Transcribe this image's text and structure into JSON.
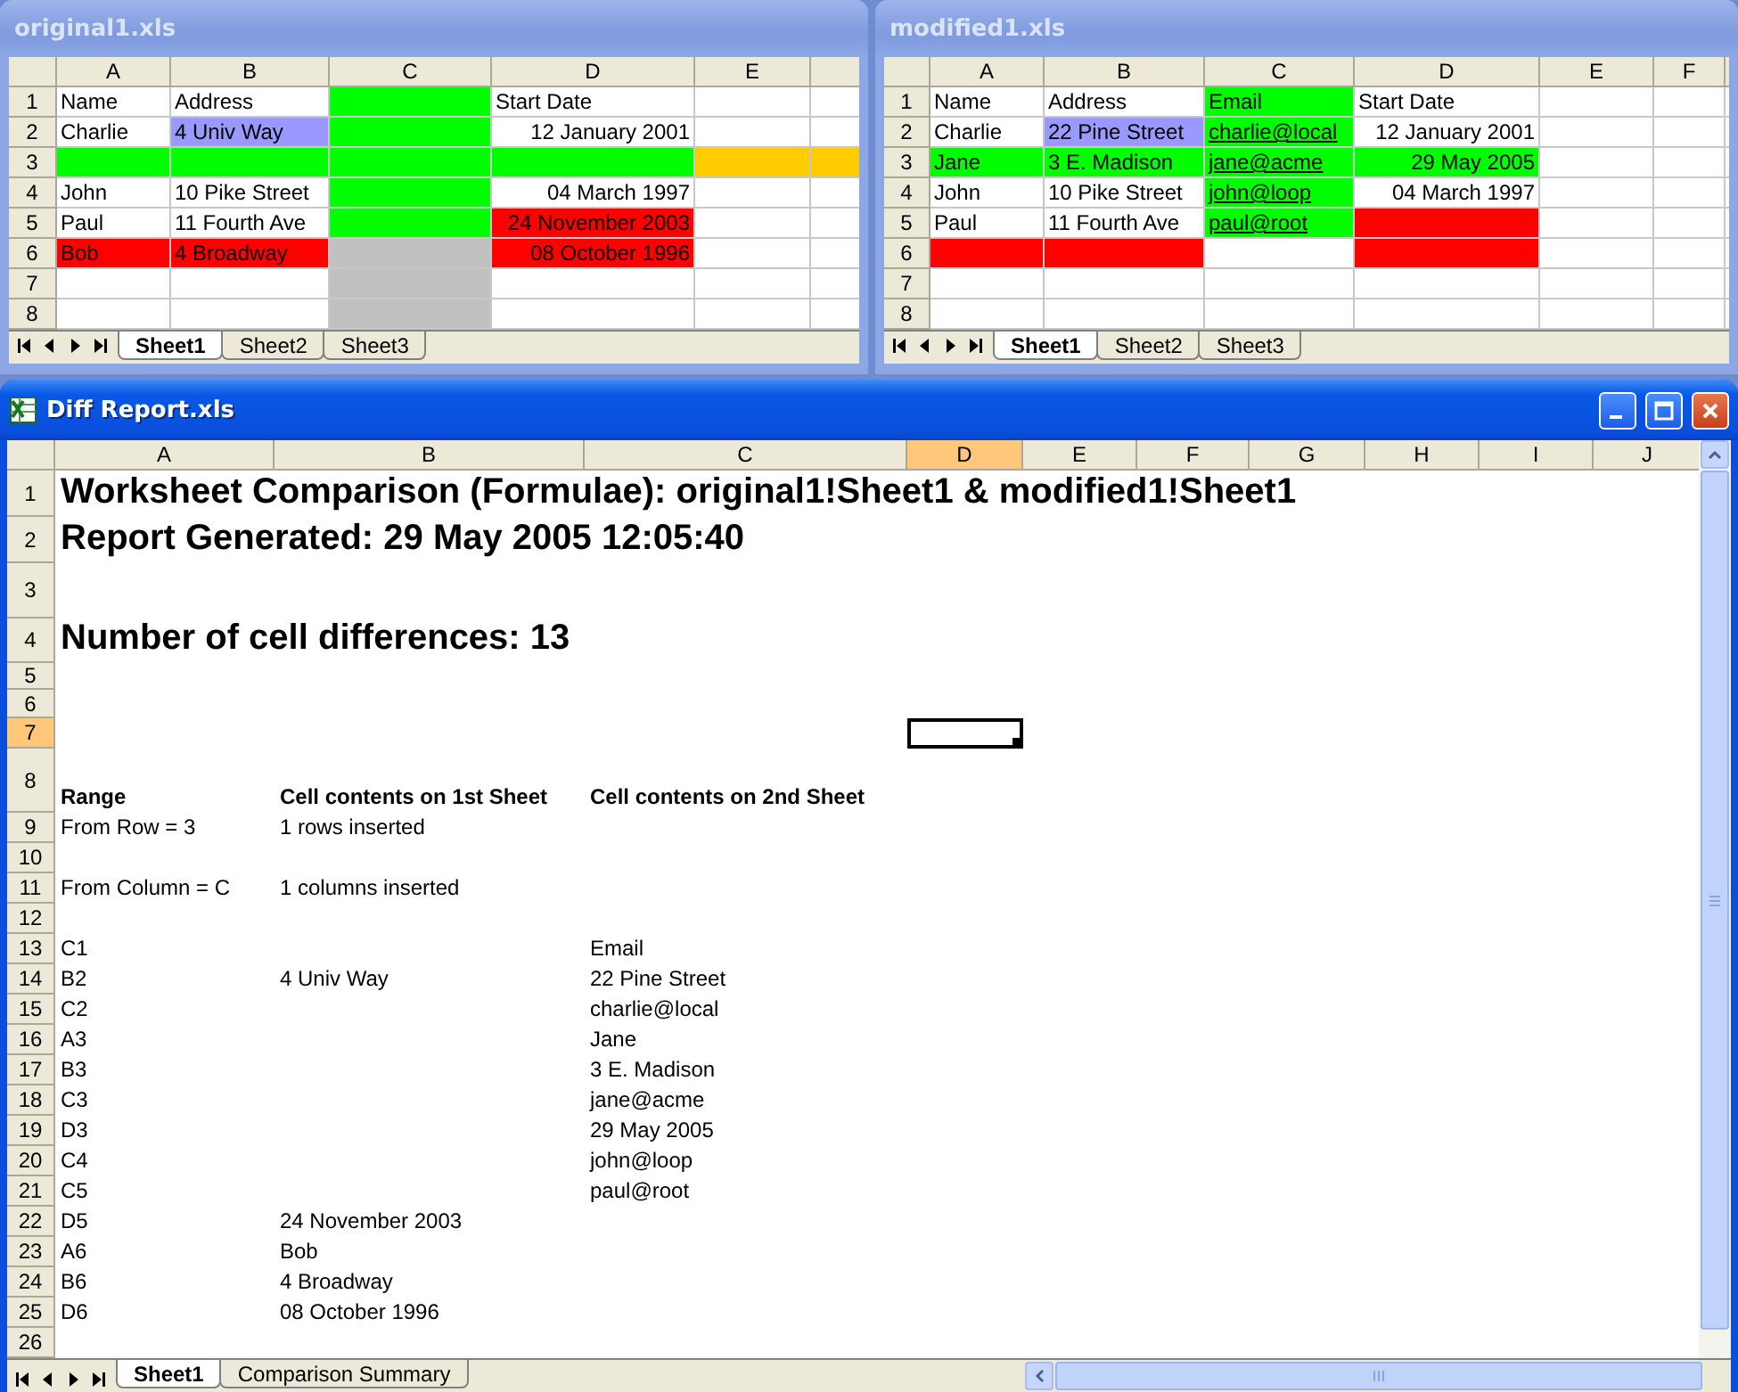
{
  "sheets": [
    {
      "title": "original1.xls",
      "columns": [
        {
          "label": "A"
        },
        {
          "label": "B"
        },
        {
          "label": "C"
        },
        {
          "label": "D"
        },
        {
          "label": "E"
        }
      ],
      "rows": [
        {
          "number": "1",
          "cells": [
            {
              "kind": "text",
              "text": "Name"
            },
            {
              "kind": "text",
              "text": "Address"
            },
            {
              "kind": "empty",
              "color": "#00ff00"
            },
            {
              "kind": "text",
              "text": "Start Date"
            },
            {
              "kind": "empty"
            }
          ]
        },
        {
          "number": "2",
          "cells": [
            {
              "kind": "text",
              "text": "Charlie"
            },
            {
              "kind": "text",
              "text": "4 Univ Way",
              "color": "#9999ff"
            },
            {
              "kind": "empty",
              "color": "#00ff00"
            },
            {
              "kind": "date",
              "text": "12 January 2001"
            },
            {
              "kind": "empty"
            }
          ]
        },
        {
          "number": "3",
          "cells": [
            {
              "kind": "empty",
              "color": "#00ff00"
            },
            {
              "kind": "empty",
              "color": "#00ff00"
            },
            {
              "kind": "empty",
              "color": "#00ff00"
            },
            {
              "kind": "empty",
              "color": "#00ff00"
            },
            {
              "kind": "empty",
              "color": "#ffcc00"
            }
          ]
        },
        {
          "number": "4",
          "cells": [
            {
              "kind": "text",
              "text": "John"
            },
            {
              "kind": "text",
              "text": "10 Pike Street"
            },
            {
              "kind": "empty",
              "color": "#00ff00"
            },
            {
              "kind": "date",
              "text": "04 March 1997"
            },
            {
              "kind": "empty"
            }
          ]
        },
        {
          "number": "5",
          "cells": [
            {
              "kind": "text",
              "text": "Paul"
            },
            {
              "kind": "text",
              "text": "11 Fourth Ave"
            },
            {
              "kind": "empty",
              "color": "#00ff00"
            },
            {
              "kind": "date",
              "text": "24 November 2003",
              "color": "#ff0000"
            },
            {
              "kind": "empty"
            }
          ]
        },
        {
          "number": "6",
          "cells": [
            {
              "kind": "text",
              "text": "Bob",
              "color": "#ff0000"
            },
            {
              "kind": "text",
              "text": "4 Broadway",
              "color": "#ff0000"
            },
            {
              "kind": "empty",
              "color": "#c0c0c0"
            },
            {
              "kind": "date",
              "text": "08 October 1996",
              "color": "#ff0000"
            },
            {
              "kind": "empty"
            }
          ]
        },
        {
          "number": "7",
          "cells": [
            {
              "kind": "empty"
            },
            {
              "kind": "empty"
            },
            {
              "kind": "empty",
              "color": "#c0c0c0"
            },
            {
              "kind": "empty"
            },
            {
              "kind": "empty"
            }
          ]
        },
        {
          "number": "8",
          "cells": [
            {
              "kind": "empty"
            },
            {
              "kind": "empty"
            },
            {
              "kind": "empty",
              "color": "#c0c0c0"
            },
            {
              "kind": "empty"
            },
            {
              "kind": "empty"
            }
          ]
        }
      ],
      "tabs": [
        {
          "label": "Sheet1",
          "selected": true
        },
        {
          "label": "Sheet2",
          "selected": false
        },
        {
          "label": "Sheet3",
          "selected": false
        }
      ]
    },
    {
      "title": "modified1.xls",
      "columns": [
        {
          "label": "A"
        },
        {
          "label": "B"
        },
        {
          "label": "C"
        },
        {
          "label": "D"
        },
        {
          "label": "E"
        },
        {
          "label": "F"
        }
      ],
      "rows": [
        {
          "number": "1",
          "cells": [
            {
              "kind": "text",
              "text": "Name"
            },
            {
              "kind": "text",
              "text": "Address"
            },
            {
              "kind": "text",
              "text": "Email",
              "color": "#00ff00"
            },
            {
              "kind": "text",
              "text": "Start Date"
            },
            {
              "kind": "empty"
            },
            {
              "kind": "empty"
            }
          ]
        },
        {
          "number": "2",
          "cells": [
            {
              "kind": "text",
              "text": "Charlie"
            },
            {
              "kind": "text",
              "text": "22 Pine Street",
              "color": "#9999ff"
            },
            {
              "kind": "link",
              "text": "charlie@local",
              "color": "#00ff00"
            },
            {
              "kind": "date",
              "text": "12 January 2001"
            },
            {
              "kind": "empty"
            },
            {
              "kind": "empty"
            }
          ]
        },
        {
          "number": "3",
          "cells": [
            {
              "kind": "text",
              "text": "Jane",
              "color": "#00ff00"
            },
            {
              "kind": "text",
              "text": "3 E. Madison",
              "color": "#00ff00"
            },
            {
              "kind": "link",
              "text": "jane@acme",
              "color": "#00ff00"
            },
            {
              "kind": "date",
              "text": "29 May 2005",
              "color": "#00ff00"
            },
            {
              "kind": "empty"
            },
            {
              "kind": "empty"
            }
          ]
        },
        {
          "number": "4",
          "cells": [
            {
              "kind": "text",
              "text": "John"
            },
            {
              "kind": "text",
              "text": "10 Pike Street"
            },
            {
              "kind": "link",
              "text": "john@loop",
              "color": "#00ff00"
            },
            {
              "kind": "date",
              "text": "04 March 1997"
            },
            {
              "kind": "empty"
            },
            {
              "kind": "empty"
            }
          ]
        },
        {
          "number": "5",
          "cells": [
            {
              "kind": "text",
              "text": "Paul"
            },
            {
              "kind": "text",
              "text": "11 Fourth Ave"
            },
            {
              "kind": "link",
              "text": "paul@root",
              "color": "#00ff00"
            },
            {
              "kind": "empty",
              "color": "#ff0000"
            },
            {
              "kind": "empty"
            },
            {
              "kind": "empty"
            }
          ]
        },
        {
          "number": "6",
          "cells": [
            {
              "kind": "empty",
              "color": "#ff0000"
            },
            {
              "kind": "empty",
              "color": "#ff0000"
            },
            {
              "kind": "empty"
            },
            {
              "kind": "empty",
              "color": "#ff0000"
            },
            {
              "kind": "empty"
            },
            {
              "kind": "empty"
            }
          ]
        },
        {
          "number": "7",
          "cells": [
            {
              "kind": "empty"
            },
            {
              "kind": "empty"
            },
            {
              "kind": "empty"
            },
            {
              "kind": "empty"
            },
            {
              "kind": "empty"
            },
            {
              "kind": "empty"
            }
          ]
        },
        {
          "number": "8",
          "cells": [
            {
              "kind": "empty"
            },
            {
              "kind": "empty"
            },
            {
              "kind": "empty"
            },
            {
              "kind": "empty"
            },
            {
              "kind": "empty"
            },
            {
              "kind": "empty"
            }
          ]
        }
      ],
      "tabs": [
        {
          "label": "Sheet1",
          "selected": true
        },
        {
          "label": "Sheet2",
          "selected": false
        },
        {
          "label": "Sheet3",
          "selected": false
        }
      ]
    }
  ],
  "report": {
    "title": "Diff Report.xls",
    "columns": [
      {
        "label": "A",
        "selected": false
      },
      {
        "label": "B",
        "selected": false
      },
      {
        "label": "C",
        "selected": false
      },
      {
        "label": "D",
        "selected": true
      },
      {
        "label": "E",
        "selected": false
      },
      {
        "label": "F",
        "selected": false
      },
      {
        "label": "G",
        "selected": false
      },
      {
        "label": "H",
        "selected": false
      },
      {
        "label": "I",
        "selected": false
      },
      {
        "label": "J",
        "selected": false
      }
    ],
    "rows": [
      {
        "number": "1",
        "kind": "title",
        "selected": false,
        "range": "Worksheet Comparison (Formulae): original1!Sheet1 & modified1!Sheet1"
      },
      {
        "number": "2",
        "kind": "title",
        "selected": false,
        "range": "Report Generated: 29 May 2005 12:05:40"
      },
      {
        "number": "3",
        "kind": "blank",
        "selected": false
      },
      {
        "number": "4",
        "kind": "title",
        "selected": false,
        "range": "Number of cell differences: 13"
      },
      {
        "number": "5",
        "kind": "blank",
        "selected": false
      },
      {
        "number": "6",
        "kind": "blank",
        "selected": false
      },
      {
        "number": "7",
        "kind": "blank",
        "selected": true
      },
      {
        "number": "8",
        "kind": "header",
        "selected": false,
        "range": "Range",
        "first": "Cell contents on 1st Sheet",
        "second": "Cell contents on 2nd Sheet"
      },
      {
        "number": "9",
        "kind": "data",
        "selected": false,
        "range": "From Row = 3",
        "first": "1 rows inserted"
      },
      {
        "number": "10",
        "kind": "blank",
        "selected": false
      },
      {
        "number": "11",
        "kind": "data",
        "selected": false,
        "range": "From Column = C",
        "first": "1 columns inserted"
      },
      {
        "number": "12",
        "kind": "blank",
        "selected": false
      },
      {
        "number": "13",
        "kind": "data",
        "selected": false,
        "range": "C1",
        "second": "Email"
      },
      {
        "number": "14",
        "kind": "data",
        "selected": false,
        "range": "B2",
        "first": "4 Univ Way",
        "second": "22 Pine Street"
      },
      {
        "number": "15",
        "kind": "data",
        "selected": false,
        "range": "C2",
        "second": "charlie@local"
      },
      {
        "number": "16",
        "kind": "data",
        "selected": false,
        "range": "A3",
        "second": "Jane"
      },
      {
        "number": "17",
        "kind": "data",
        "selected": false,
        "range": "B3",
        "second": "3 E. Madison"
      },
      {
        "number": "18",
        "kind": "data",
        "selected": false,
        "range": "C3",
        "second": "jane@acme"
      },
      {
        "number": "19",
        "kind": "data",
        "selected": false,
        "range": "D3",
        "second": "29 May 2005"
      },
      {
        "number": "20",
        "kind": "data",
        "selected": false,
        "range": "C4",
        "second": "john@loop"
      },
      {
        "number": "21",
        "kind": "data",
        "selected": false,
        "range": "C5",
        "second": "paul@root"
      },
      {
        "number": "22",
        "kind": "data",
        "selected": false,
        "range": "D5",
        "first": "24 November 2003"
      },
      {
        "number": "23",
        "kind": "data",
        "selected": false,
        "range": "A6",
        "first": "Bob"
      },
      {
        "number": "24",
        "kind": "data",
        "selected": false,
        "range": "B6",
        "first": "4 Broadway"
      },
      {
        "number": "25",
        "kind": "data",
        "selected": false,
        "range": "D6",
        "first": "08 October 1996"
      },
      {
        "number": "26",
        "kind": "blank",
        "selected": false
      }
    ],
    "tabs": [
      {
        "label": "Sheet1",
        "selected": true
      },
      {
        "label": "Comparison Summary",
        "selected": false
      }
    ]
  }
}
